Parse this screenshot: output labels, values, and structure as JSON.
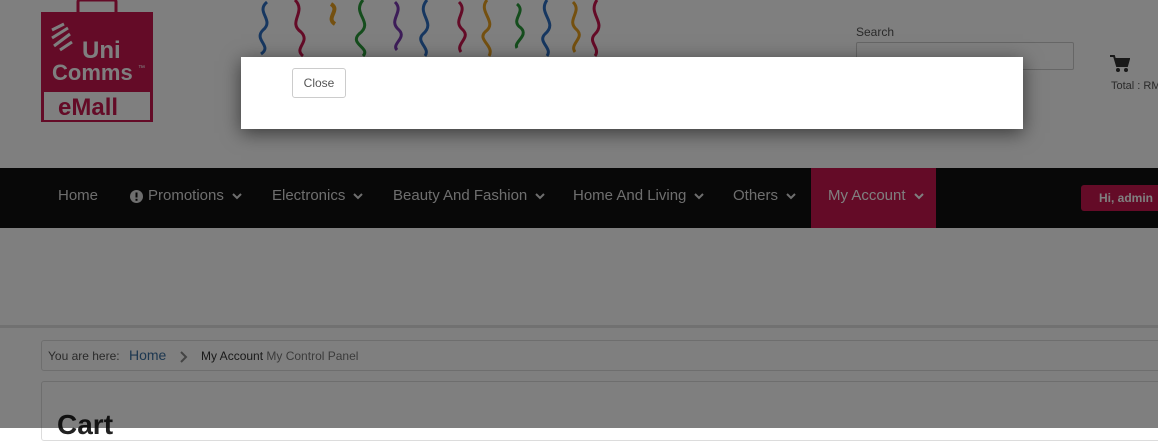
{
  "logo": {
    "line1": "Uni",
    "line2": "Comms",
    "line3": "eMall",
    "tm": "™"
  },
  "search": {
    "label": "Search",
    "value": ""
  },
  "cart": {
    "icon": "shopping-cart-icon",
    "total_label": "Total : RM"
  },
  "nav": {
    "items": [
      {
        "label": "Home"
      },
      {
        "label": "Promotions",
        "icon": "exclamation-circle-icon"
      },
      {
        "label": "Electronics"
      },
      {
        "label": "Beauty And Fashion"
      },
      {
        "label": "Home And Living"
      },
      {
        "label": "Others"
      },
      {
        "label": "My Account",
        "active": true
      }
    ],
    "greeting": "Hi, admin"
  },
  "breadcrumb": {
    "prefix": "You are here:",
    "home": "Home",
    "current": "My Account",
    "sub": "My Control Panel"
  },
  "main": {
    "heading": "Cart"
  },
  "modal": {
    "close_label": "Close"
  },
  "colors": {
    "brand": "#c8174f",
    "navbar": "#111111",
    "overlay": "rgba(0,0,0,0.5)"
  }
}
